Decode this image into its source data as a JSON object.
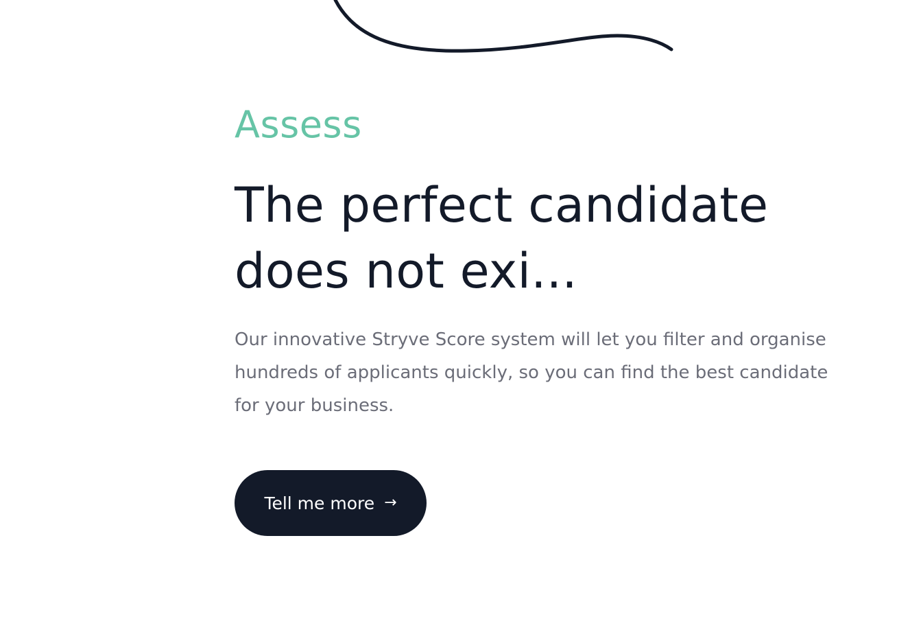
{
  "section": {
    "eyebrow": "Assess",
    "headline": "The perfect candidate does not exi...",
    "body": "Our innovative Stryve Score system will let you filter and organise hundreds of applicants quickly, so you can find the best candidate for your business."
  },
  "cta": {
    "label": "Tell me more",
    "icon": "arrow-right-icon"
  },
  "colors": {
    "accent": "#66c4a6",
    "primary": "#131a29",
    "body_text": "#6b6d78",
    "background": "#ffffff"
  }
}
